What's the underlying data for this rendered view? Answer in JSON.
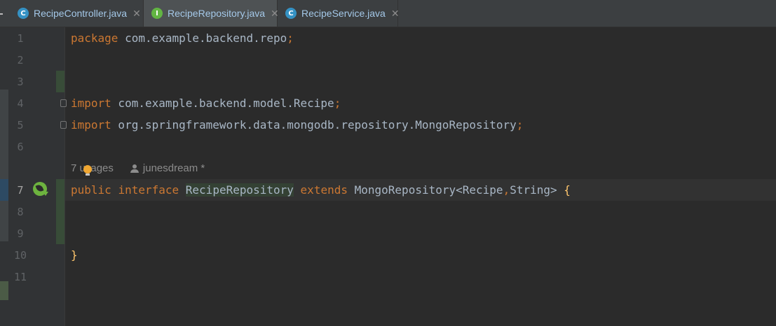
{
  "tabs": [
    {
      "badge": "C",
      "label": "RecipeController.java",
      "close": "✕"
    },
    {
      "badge": "I",
      "label": "RecipeRepository.java",
      "close": "✕"
    },
    {
      "badge": "C",
      "label": "RecipeService.java",
      "close": "✕"
    }
  ],
  "gutter": {
    "line_numbers": [
      "1",
      "2",
      "3",
      "4",
      "5",
      "6",
      "7",
      "8",
      "9",
      "10",
      "11"
    ]
  },
  "code": {
    "line1": {
      "kw": "package",
      "text": " com.example.backend.repo",
      "punc": ";"
    },
    "line4": {
      "kw": "import",
      "text": " com.example.backend.model.Recipe",
      "punc": ";"
    },
    "line5": {
      "kw": "import",
      "text": " org.springframework.data.mongodb.repository.MongoRepository",
      "punc": ";"
    },
    "line7": {
      "kw_public": "public",
      "kw_interface": "interface",
      "name": "RecipeRepository",
      "kw_extends": "extends",
      "base": "MongoRepository",
      "generic_open": "<",
      "type1": "Recipe",
      "comma": ",",
      "type2": "String",
      "generic_close": ">",
      "brace_open": "{"
    },
    "line10": {
      "brace_close": "}"
    }
  },
  "inlay": {
    "usages": "7 usages",
    "author": "junesdream *"
  },
  "colors": {
    "keyword": "#cc7832",
    "text": "#a9b7c6",
    "brace": "#ffc66d",
    "line_number": "#606366",
    "background": "#2b2b2b",
    "spring": "#6db33f"
  }
}
